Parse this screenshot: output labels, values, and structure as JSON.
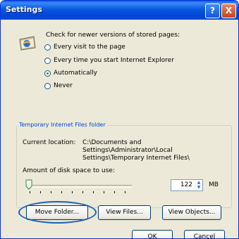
{
  "window": {
    "title": "Settings"
  },
  "titlebar": {
    "help_label": "?",
    "close_label": "X"
  },
  "check": {
    "text": "Check for newer versions of stored pages:",
    "options": [
      {
        "label": "Every visit to the page",
        "selected": false
      },
      {
        "label": "Every time you start Internet Explorer",
        "selected": false
      },
      {
        "label": "Automatically",
        "selected": true
      },
      {
        "label": "Never",
        "selected": false
      }
    ]
  },
  "temp_folder": {
    "group_title": "Temporary Internet Files folder",
    "current_location_label": "Current location:",
    "current_location_line1": "C:\\Documents and",
    "current_location_line2": "Settings\\Administrator\\Local",
    "current_location_line3": "Settings\\Temporary Internet Files\\",
    "disk_space_label": "Amount of disk space to use:",
    "disk_space_value": "122",
    "disk_space_unit": "MB",
    "slider_level_fraction": 0
  },
  "buttons": {
    "move_folder": "Move Folder...",
    "view_files": "View Files...",
    "view_objects": "View Objects...",
    "ok": "OK",
    "cancel": "Cancel"
  }
}
